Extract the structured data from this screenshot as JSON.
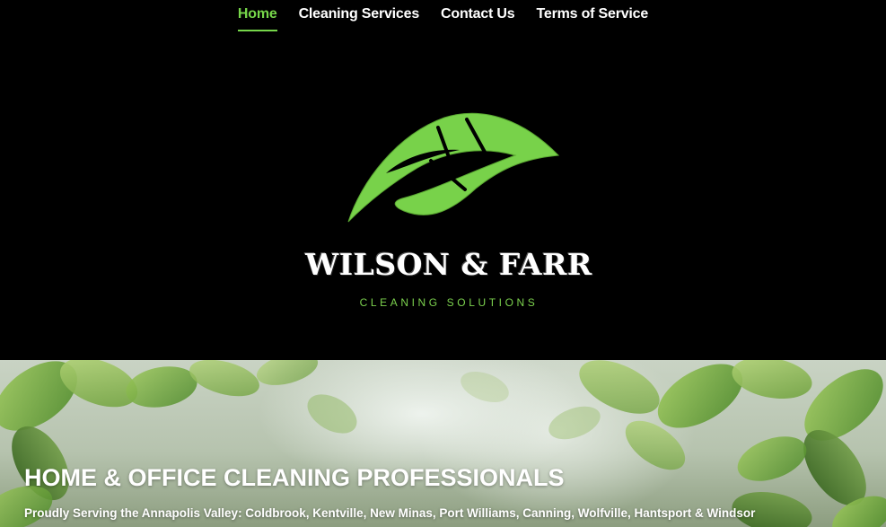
{
  "nav": {
    "items": [
      {
        "label": "Home",
        "active": true
      },
      {
        "label": "Cleaning Services",
        "active": false
      },
      {
        "label": "Contact Us",
        "active": false
      },
      {
        "label": "Terms of Service",
        "active": false
      }
    ]
  },
  "logo": {
    "icon": "leaf-icon",
    "name": "WILSON & FARR",
    "tagline": "CLEANING SOLUTIONS"
  },
  "hero": {
    "title": "HOME & OFFICE CLEANING PROFESSIONALS",
    "subtitle": "Proudly Serving the Annapolis Valley: Coldbrook, Kentville, New Minas, Port Williams, Canning, Wolfville, Hantsport & Windsor"
  },
  "colors": {
    "accent": "#76d64a",
    "header_bg": "#000000",
    "text": "#ffffff"
  }
}
